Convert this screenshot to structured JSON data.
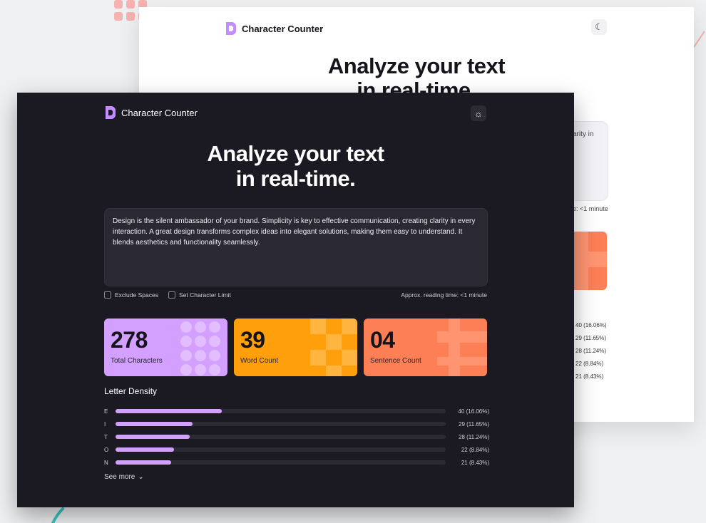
{
  "decor": {
    "accent_pink": "#f6b2b0",
    "accent_teal": "#3cc6c2"
  },
  "light_window": {
    "brand": "Character Counter",
    "theme_icon": "moon-icon",
    "hero_line1": "Analyze your text",
    "hero_line2": "in real-time.",
    "peek_text_1": "arity in",
    "peek_reading": "e: <1 minute",
    "density_values": [
      "40 (16.06%)",
      "29 (11.65%)",
      "28 (11.24%)",
      "22 (8.84%)",
      "21 (8.43%)"
    ]
  },
  "dark_window": {
    "brand": "Character Counter",
    "theme_icon": "sun-icon",
    "hero_line1": "Analyze your text",
    "hero_line2": "in real-time.",
    "text_value": "Design is the silent ambassador of your brand. Simplicity is key to effective communication, creating clarity in every interaction. A great design transforms complex ideas into elegant solutions, making them easy to understand. It blends aesthetics and functionality seamlessly.",
    "options": {
      "exclude_spaces": "Exclude Spaces",
      "set_limit": "Set Character Limit"
    },
    "reading_time": "Approx. reading time: <1 minute",
    "cards": [
      {
        "value": "278",
        "label": "Total Characters",
        "color": "#d3a0ff"
      },
      {
        "value": "39",
        "label": "Word Count",
        "color": "#ff9f0b"
      },
      {
        "value": "04",
        "label": "Sentence Count",
        "color": "#fd7f55"
      }
    ],
    "density_title": "Letter Density",
    "density": [
      {
        "letter": "E",
        "value": "40 (16.06%)",
        "fraction": 0.1606
      },
      {
        "letter": "I",
        "value": "29 (11.65%)",
        "fraction": 0.1165
      },
      {
        "letter": "T",
        "value": "28 (11.24%)",
        "fraction": 0.1124
      },
      {
        "letter": "O",
        "value": "22 (8.84%)",
        "fraction": 0.0884
      },
      {
        "letter": "N",
        "value": "21 (8.43%)",
        "fraction": 0.0843
      }
    ],
    "see_more": "See more"
  }
}
